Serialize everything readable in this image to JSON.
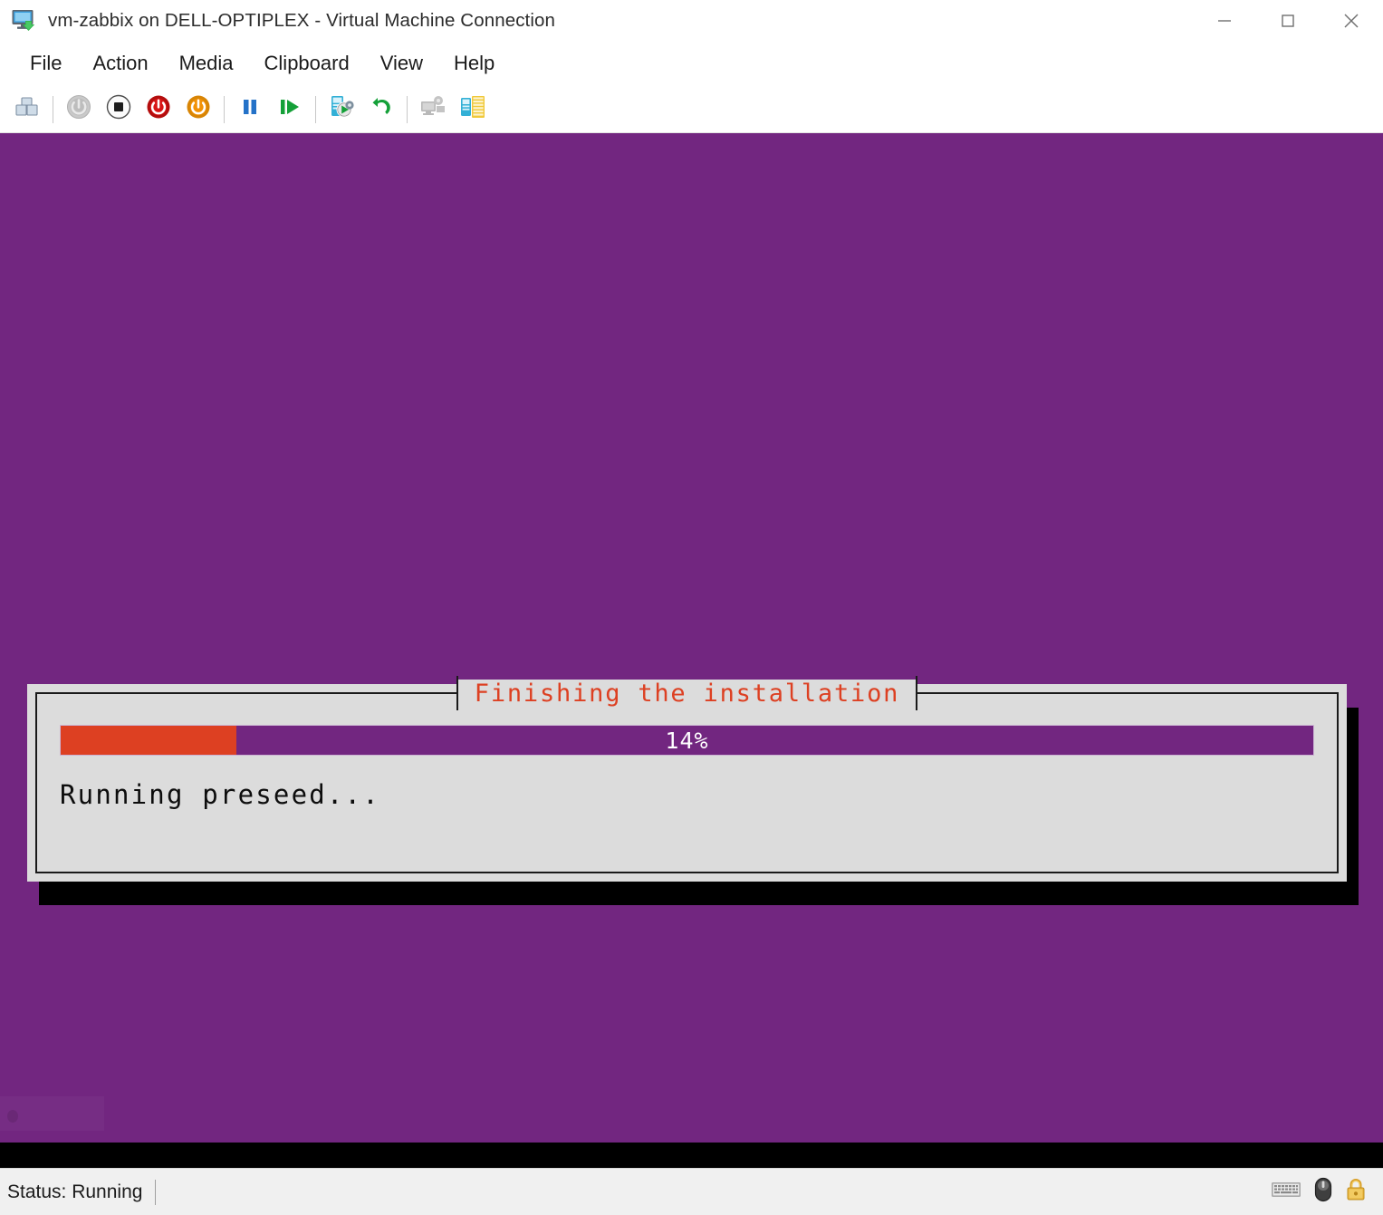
{
  "window": {
    "title": "vm-zabbix on DELL-OPTIPLEX - Virtual Machine Connection",
    "icon": "virtual-machine-icon",
    "controls": {
      "minimize": "—",
      "maximize": "☐",
      "close": "✕"
    }
  },
  "menubar": {
    "items": [
      {
        "label": "File"
      },
      {
        "label": "Action"
      },
      {
        "label": "Media"
      },
      {
        "label": "Clipboard"
      },
      {
        "label": "View"
      },
      {
        "label": "Help"
      }
    ]
  },
  "toolbar": {
    "buttons": [
      {
        "icon": "ctrl-alt-delete-icon",
        "name": "ctrl-alt-delete-button",
        "enabled": true
      },
      {
        "icon": "start-icon",
        "name": "start-button",
        "enabled": false
      },
      {
        "icon": "turn-off-icon",
        "name": "turn-off-button",
        "enabled": true
      },
      {
        "icon": "shut-down-icon",
        "name": "shut-down-button",
        "enabled": true
      },
      {
        "icon": "save-icon",
        "name": "save-button",
        "enabled": true
      },
      {
        "icon": "pause-icon",
        "name": "pause-button",
        "enabled": true
      },
      {
        "icon": "resume-icon",
        "name": "resume-button",
        "enabled": true
      },
      {
        "icon": "checkpoint-icon",
        "name": "checkpoint-button",
        "enabled": true
      },
      {
        "icon": "revert-icon",
        "name": "revert-button",
        "enabled": true
      },
      {
        "icon": "move-icon",
        "name": "move-button",
        "enabled": false
      },
      {
        "icon": "enhanced-session-icon",
        "name": "enhanced-session-button",
        "enabled": true
      }
    ]
  },
  "vm_screen": {
    "background_color": "#722680",
    "dialog": {
      "title": "Finishing the installation",
      "title_color": "#dd4022",
      "progress_percent": 14,
      "progress_label": "14%",
      "progress_fill_color": "#dd4022",
      "progress_track_color": "#722680",
      "message": "Running preseed...",
      "panel_color": "#dcdcdc"
    }
  },
  "statusbar": {
    "status": "Status: Running",
    "icons": [
      {
        "name": "keyboard-icon"
      },
      {
        "name": "mouse-icon"
      },
      {
        "name": "lock-icon"
      }
    ]
  }
}
